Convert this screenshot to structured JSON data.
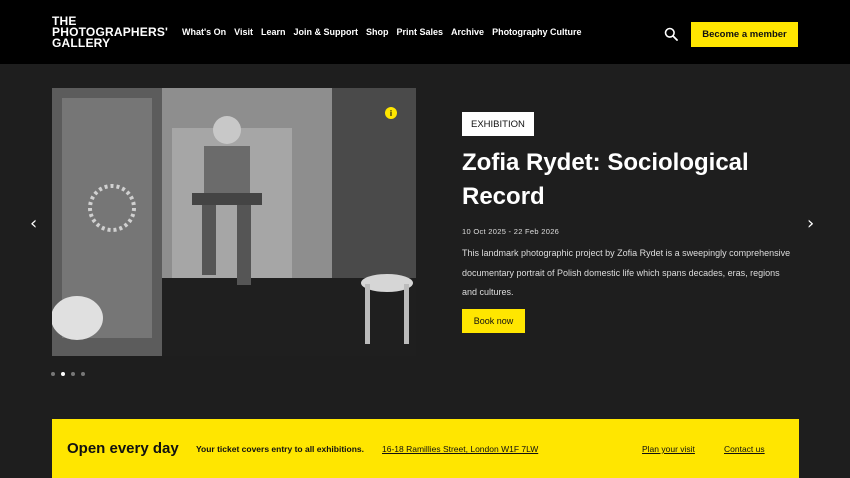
{
  "header": {
    "logo_lines": [
      "THE",
      "PHOTOGRAPHERS'",
      "GALLERY"
    ],
    "nav": [
      "What's On",
      "Visit",
      "Learn",
      "Join & Support",
      "Shop",
      "Print Sales",
      "Archive",
      "Photography Culture"
    ],
    "search_icon": "search-icon",
    "member_label": "Become a member"
  },
  "hero": {
    "info_label": "i",
    "prev_arrow": "‹",
    "next_arrow": "›",
    "tag": "EXHIBITION",
    "title": "Zofia Rydet: Sociological Record",
    "dates": "10 Oct 2025 - 22 Feb 2026",
    "description": "This landmark photographic project by Zofia Rydet is a sweepingly comprehensive documentary portrait of Polish domestic life which spans decades, eras, regions and cultures.",
    "book_label": "Book now",
    "slide_count": 4,
    "active_slide": 2
  },
  "banner": {
    "open": "Open every day",
    "covers": "Your ticket covers entry to all exhibitions.",
    "address": "16-18 Ramillies Street, London W1F 7LW",
    "plan": "Plan your visit",
    "contact": "Contact us"
  },
  "colors": {
    "accent": "#ffe600",
    "header_bg": "#000000",
    "page_bg": "#1e1e1e"
  }
}
